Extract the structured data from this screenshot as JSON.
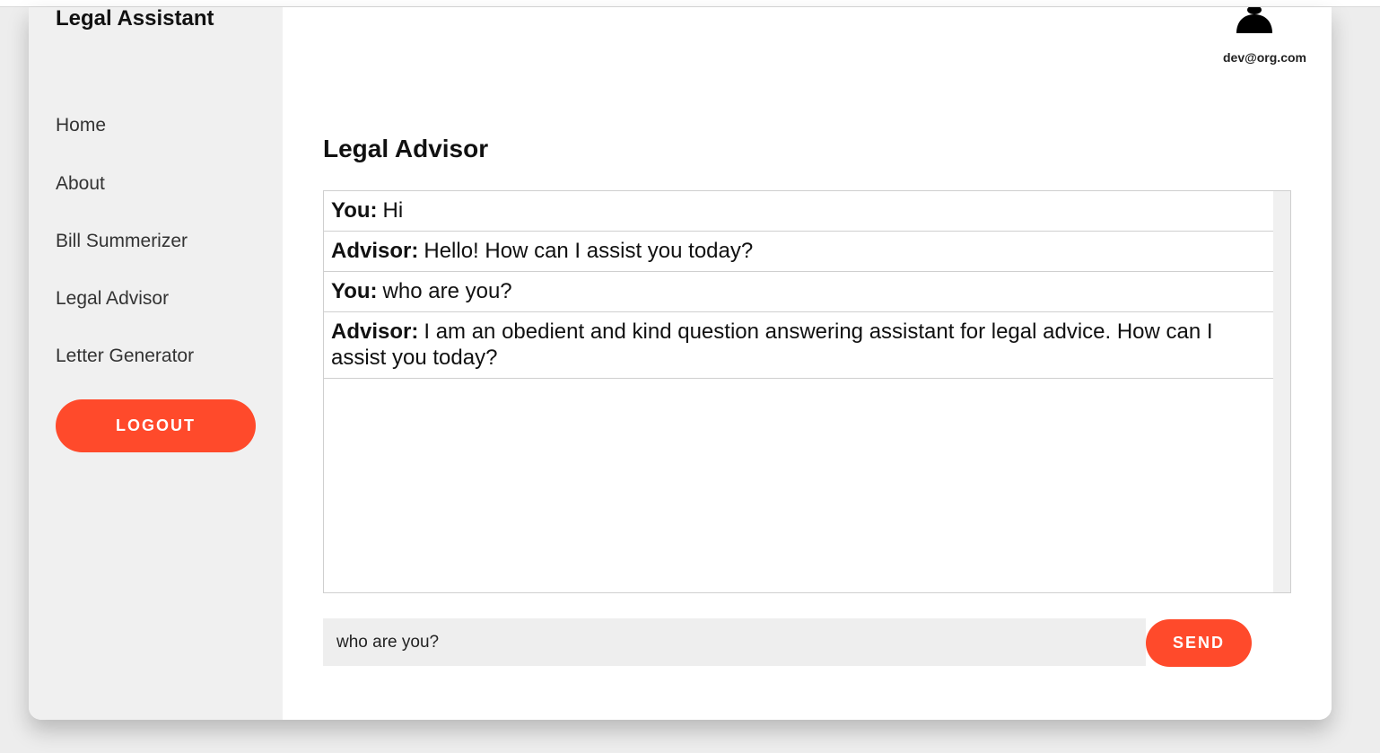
{
  "sidebar": {
    "brand": "Legal Assistant",
    "nav": [
      "Home",
      "About",
      "Bill Summerizer",
      "Legal Advisor",
      "Letter Generator"
    ],
    "logout_label": "LOGOUT"
  },
  "header": {
    "user_email": "dev@org.com",
    "avatar_icon": "user-icon"
  },
  "main": {
    "title": "Legal Advisor",
    "messages": [
      {
        "sender": "You:",
        "text": "Hi"
      },
      {
        "sender": "Advisor:",
        "text": "Hello! How can I assist you today?"
      },
      {
        "sender": "You:",
        "text": "who are you?"
      },
      {
        "sender": "Advisor:",
        "text": "I am an obedient and kind question answering assistant for legal advice. How can I assist you today?"
      }
    ],
    "input_value": "who are you?",
    "send_label": "SEND"
  },
  "colors": {
    "accent": "#ff4a2b",
    "sidebar_bg": "#f0f0f0"
  }
}
